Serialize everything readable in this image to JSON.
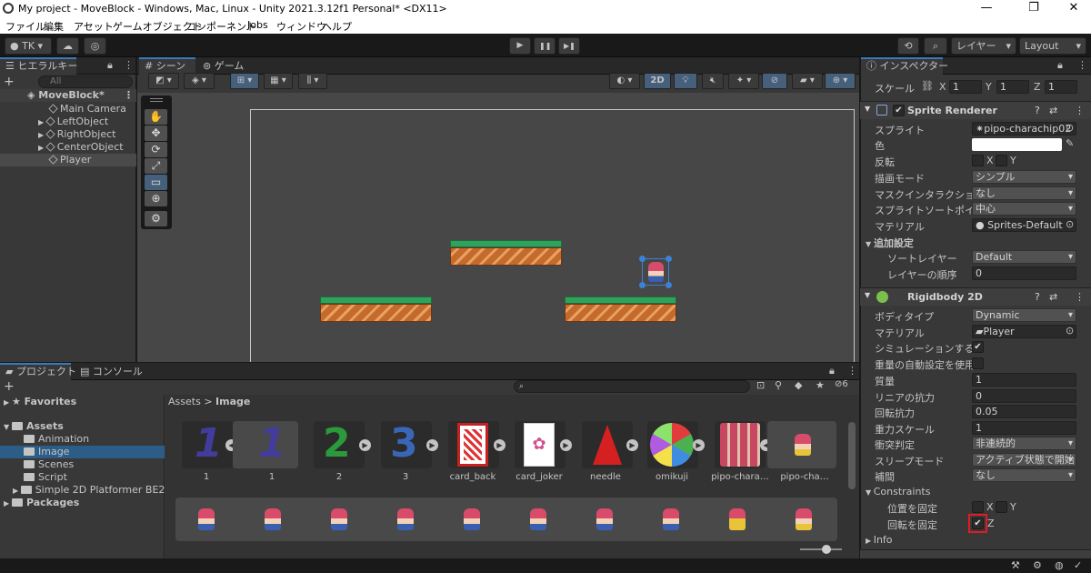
{
  "window": {
    "title": "My project - MoveBlock - Windows, Mac, Linux - Unity 2021.3.12f1 Personal* <DX11>",
    "min": "—",
    "max": "❐",
    "close": "✕"
  },
  "menu": [
    "ファイル",
    "編集",
    "アセット",
    "ゲームオブジェクト",
    "コンポーネント",
    "Jobs",
    "ウィンドウ",
    "ヘルプ"
  ],
  "toolbar": {
    "account": "TK",
    "layers": "レイヤー",
    "layout": "Layout",
    "play": "▶",
    "pause": "❚❚",
    "step": "▶❚"
  },
  "hierarchy": {
    "tab": "ヒエラルキー",
    "add": "+",
    "search_placeholder": "All",
    "scene": "MoveBlock*",
    "items": [
      "Main Camera",
      "LeftObject",
      "RightObject",
      "CenterObject",
      "Player"
    ]
  },
  "scene_tabs": {
    "scene": "シーン",
    "game": "ゲーム",
    "mode2d": "2D"
  },
  "tools": [
    "✋",
    "✥",
    "⟳",
    "⤢",
    "▭",
    "⊕",
    "⚙"
  ],
  "project": {
    "tab": "プロジェクト",
    "console": "コンソール",
    "add": "+",
    "hidden_count": "6",
    "breadcrumb_root": "Assets",
    "breadcrumb_sep": ">",
    "breadcrumb_current": "Image",
    "favorites": "Favorites",
    "assets": "Assets",
    "folders": [
      "Animation",
      "Image",
      "Scenes",
      "Script",
      "Simple 2D Platformer BE2"
    ],
    "packages": "Packages",
    "asset_labels": [
      "1",
      "1",
      "2",
      "3",
      "card_back",
      "card_joker",
      "needle",
      "omikuji",
      "pipo-chara…",
      "pipo-cha…"
    ]
  },
  "inspector": {
    "tab": "インスペクター",
    "scale_label": "スケール",
    "scale_x_label": "X",
    "scale_x": "1",
    "scale_y_label": "Y",
    "scale_y": "1",
    "scale_z_label": "Z",
    "scale_z": "1",
    "sprite_renderer": {
      "title": "Sprite Renderer",
      "sprite_label": "スプライト",
      "sprite": "pipo-charachip02",
      "color_label": "色",
      "flip_label": "反転",
      "flip_x": "X",
      "flip_y": "Y",
      "draw_mode_label": "描画モード",
      "draw_mode": "シンプル",
      "mask_label": "マスクインタラクション",
      "mask": "なし",
      "pivot_label": "スプライトソートポイント",
      "pivot": "中心",
      "material_label": "マテリアル",
      "material": "Sprites-Default",
      "additional_label": "追加設定",
      "sorting_layer_label": "ソートレイヤー",
      "sorting_layer": "Default",
      "order_label": "レイヤーの順序",
      "order": "0"
    },
    "rigidbody": {
      "title": "Rigidbody 2D",
      "body_type_label": "ボディタイプ",
      "body_type": "Dynamic",
      "material_label": "マテリアル",
      "material": "Player",
      "simulated_label": "シミュレーションする",
      "auto_mass_label": "重量の自動設定を使用",
      "mass_label": "質量",
      "mass": "1",
      "linear_drag_label": "リニアの抗力",
      "linear_drag": "0",
      "angular_drag_label": "回転抗力",
      "angular_drag": "0.05",
      "gravity_label": "重力スケール",
      "gravity": "1",
      "collision_label": "衝突判定",
      "collision": "非連続的",
      "sleep_label": "スリープモード",
      "sleep": "アクティブ状態で開始",
      "interp_label": "補間",
      "interp": "なし",
      "constraints_label": "Constraints",
      "freeze_pos_label": "位置を固定",
      "freeze_pos_x": "X",
      "freeze_pos_y": "Y",
      "freeze_rot_label": "回転を固定",
      "freeze_rot_z": "Z",
      "info_label": "Info"
    }
  },
  "colors": {
    "highlight": "#e01b24",
    "accent": "#3a79bb"
  }
}
